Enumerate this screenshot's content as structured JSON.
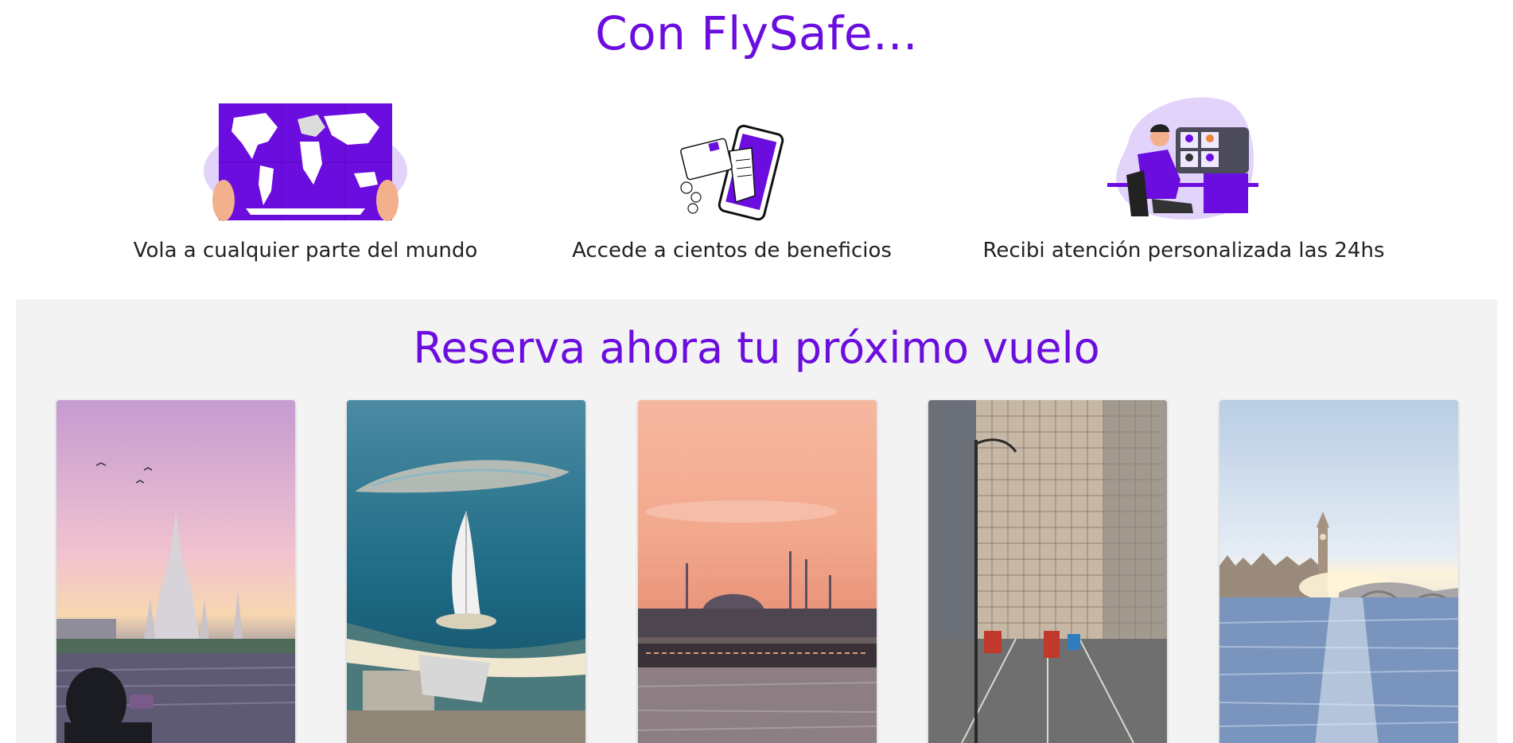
{
  "hero": {
    "title": "Con FlySafe..."
  },
  "features": [
    {
      "label": "Vola a cualquier parte del mundo",
      "icon": "world-map-illustration"
    },
    {
      "label": "Accede a cientos de beneficios",
      "icon": "phone-payment-illustration"
    },
    {
      "label": "Recibi atención personalizada las 24hs",
      "icon": "support-agent-illustration"
    }
  ],
  "booking": {
    "title": "Reserva ahora tu próximo vuelo",
    "destinations": [
      {
        "image": "bangkok-temple-photo"
      },
      {
        "image": "dubai-burj-al-arab-photo"
      },
      {
        "image": "istanbul-mosque-photo"
      },
      {
        "image": "hong-kong-street-photo"
      },
      {
        "image": "london-big-ben-photo"
      }
    ]
  },
  "colors": {
    "accent": "#6a0dde",
    "light_accent": "#e2d3fb",
    "section_bg": "#f3f3f3"
  }
}
